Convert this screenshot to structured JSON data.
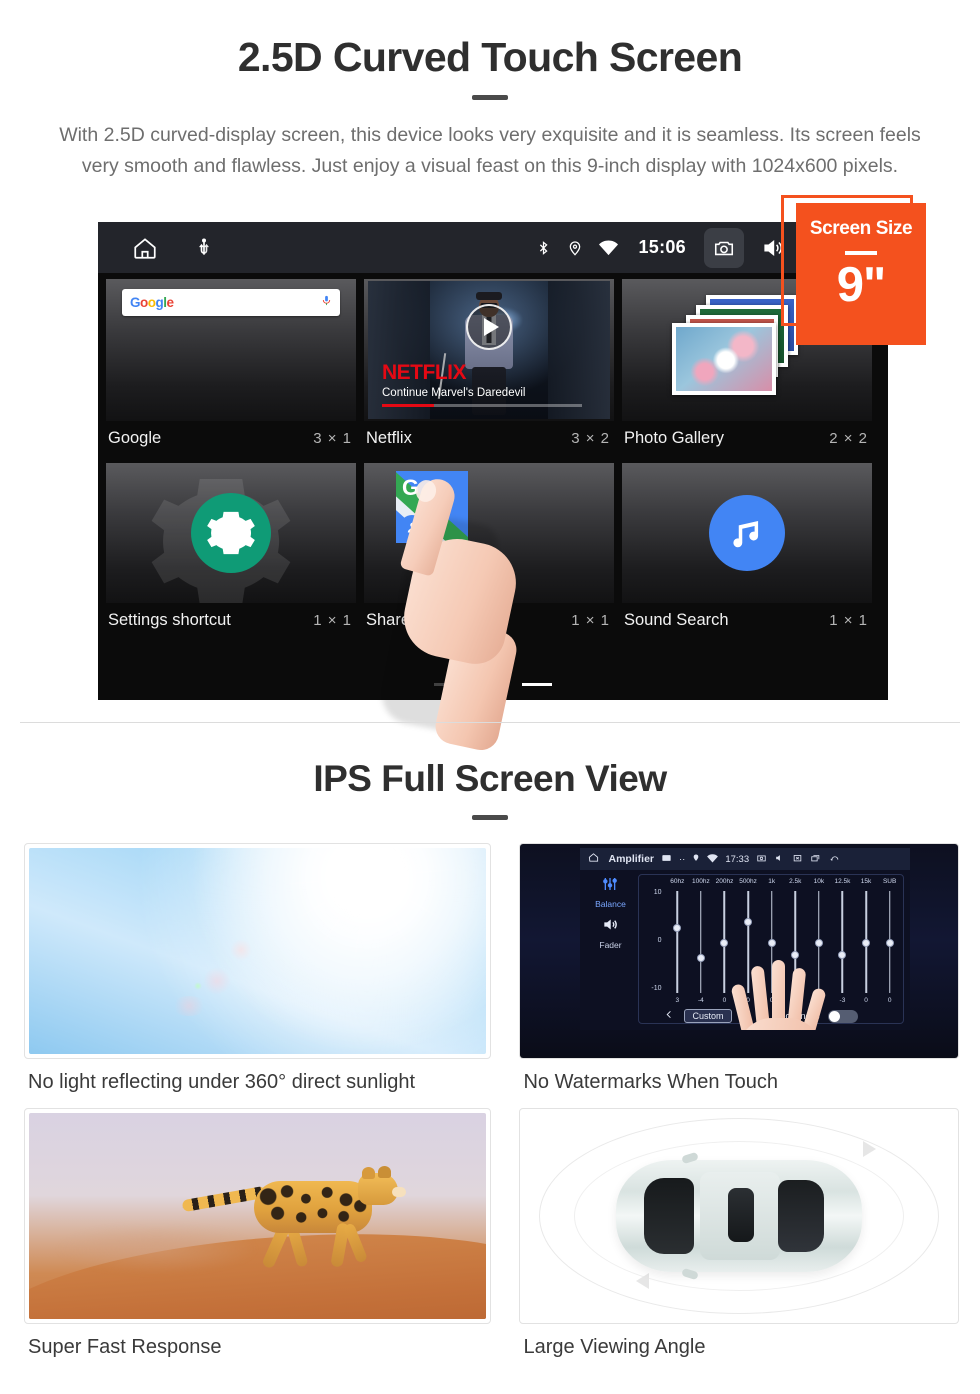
{
  "section1": {
    "title": "2.5D Curved Touch Screen",
    "description": "With 2.5D curved-display screen, this device looks very exquisite and it is seamless. Its screen feels very smooth and flawless. Just enjoy a visual feast on this 9-inch display with 1024x600 pixels."
  },
  "badge": {
    "title": "Screen Size",
    "value": "9\"",
    "color": "#f4511e"
  },
  "device_screen": {
    "statusbar": {
      "time": "15:06",
      "left_icons": [
        "home-icon",
        "usb-icon"
      ],
      "right_icons": [
        "bluetooth-icon",
        "location-icon",
        "wifi-icon",
        "camera-icon",
        "volume-icon",
        "close-icon",
        "recents-icon"
      ]
    },
    "widgets": [
      {
        "name": "Google",
        "size": "3 × 1",
        "thumb": "google-search-widget",
        "search_brand": "Google",
        "mic": "mic-icon"
      },
      {
        "name": "Netflix",
        "size": "3 × 2",
        "thumb": "netflix-widget",
        "brand": "NETFLIX",
        "subtitle": "Continue Marvel's Daredevil"
      },
      {
        "name": "Photo Gallery",
        "size": "2 × 2",
        "thumb": "photo-gallery-widget"
      },
      {
        "name": "Settings shortcut",
        "size": "1 × 1",
        "thumb": "settings-gear-widget"
      },
      {
        "name": "Share location",
        "size": "1 × 1",
        "thumb": "google-maps-widget"
      },
      {
        "name": "Sound Search",
        "size": "1 × 1",
        "thumb": "sound-search-widget"
      }
    ],
    "page_indicator": {
      "count": 3,
      "active": 3
    }
  },
  "section2": {
    "title": "IPS Full Screen View",
    "cards": [
      {
        "caption": "No light reflecting under 360° direct sunlight",
        "media": "sunlight-sky-photo"
      },
      {
        "caption": "No Watermarks When Touch",
        "media": "amplifier-equalizer-screenshot"
      },
      {
        "caption": "Super Fast Response",
        "media": "running-cheetah-photo"
      },
      {
        "caption": "Large Viewing Angle",
        "media": "car-top-view-illustration"
      }
    ]
  },
  "amplifier": {
    "statusbar": {
      "title": "Amplifier",
      "time": "17:33"
    },
    "side_tabs": [
      {
        "label": "Balance",
        "icon": "sliders-icon"
      },
      {
        "label": "Fader",
        "icon": "speaker-icon"
      }
    ],
    "scale_labels": [
      "10",
      "0",
      "-10"
    ],
    "bands": [
      "60hz",
      "100hz",
      "200hz",
      "500hz",
      "1k",
      "2.5k",
      "10k",
      "12.5k",
      "15k",
      "SUB"
    ],
    "values": [
      "3",
      "-4",
      "0",
      "0",
      "0",
      "-3",
      "0",
      "-3",
      "0",
      "0"
    ],
    "preset_button": "Custom",
    "loudness_label": "loudness",
    "loudness_on": false
  }
}
